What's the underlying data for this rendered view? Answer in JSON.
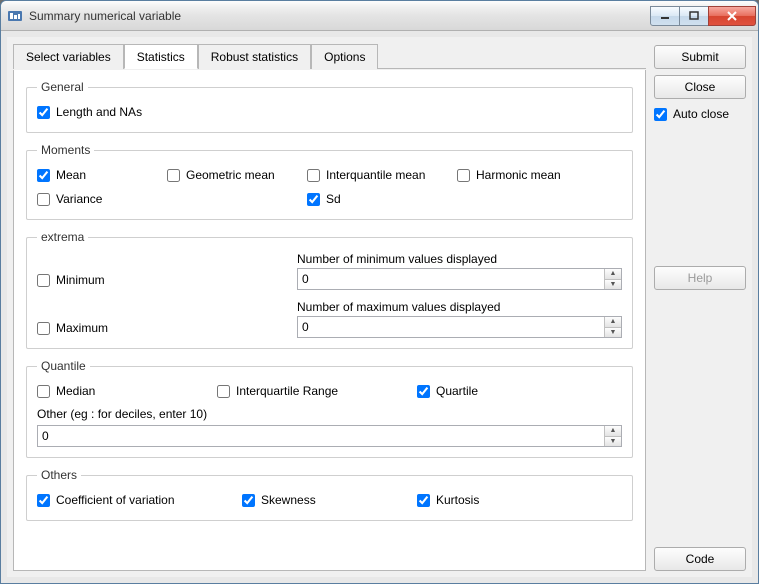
{
  "window": {
    "title": "Summary numerical variable"
  },
  "tabs": [
    {
      "id": "select",
      "label": "Select variables"
    },
    {
      "id": "stats",
      "label": "Statistics"
    },
    {
      "id": "robust",
      "label": "Robust statistics"
    },
    {
      "id": "options",
      "label": "Options"
    }
  ],
  "active_tab": "stats",
  "groups": {
    "general": {
      "legend": "General",
      "length_nas": {
        "label": "Length and NAs",
        "checked": true
      }
    },
    "moments": {
      "legend": "Moments",
      "mean": {
        "label": "Mean",
        "checked": true
      },
      "geomean": {
        "label": "Geometric mean",
        "checked": false
      },
      "iqmean": {
        "label": "Interquantile mean",
        "checked": false
      },
      "harmean": {
        "label": "Harmonic mean",
        "checked": false
      },
      "variance": {
        "label": "Variance",
        "checked": false
      },
      "sd": {
        "label": "Sd",
        "checked": true
      }
    },
    "extrema": {
      "legend": "extrema",
      "minimum": {
        "label": "Minimum",
        "checked": false
      },
      "maximum": {
        "label": "Maximum",
        "checked": false
      },
      "min_disp_label": "Number of minimum values displayed",
      "min_disp_value": "0",
      "max_disp_label": "Number of maximum values displayed",
      "max_disp_value": "0"
    },
    "quantile": {
      "legend": "Quantile",
      "median": {
        "label": "Median",
        "checked": false
      },
      "iqr": {
        "label": "Interquartile Range",
        "checked": false
      },
      "quartile": {
        "label": "Quartile",
        "checked": true
      },
      "other_label": "Other (eg : for deciles, enter 10)",
      "other_value": "0"
    },
    "others": {
      "legend": "Others",
      "cv": {
        "label": "Coefficient of variation",
        "checked": true
      },
      "skew": {
        "label": "Skewness",
        "checked": true
      },
      "kurt": {
        "label": "Kurtosis",
        "checked": true
      }
    }
  },
  "buttons": {
    "submit": "Submit",
    "close": "Close",
    "help": "Help",
    "code": "Code"
  },
  "auto_close": {
    "label": "Auto close",
    "checked": true
  }
}
